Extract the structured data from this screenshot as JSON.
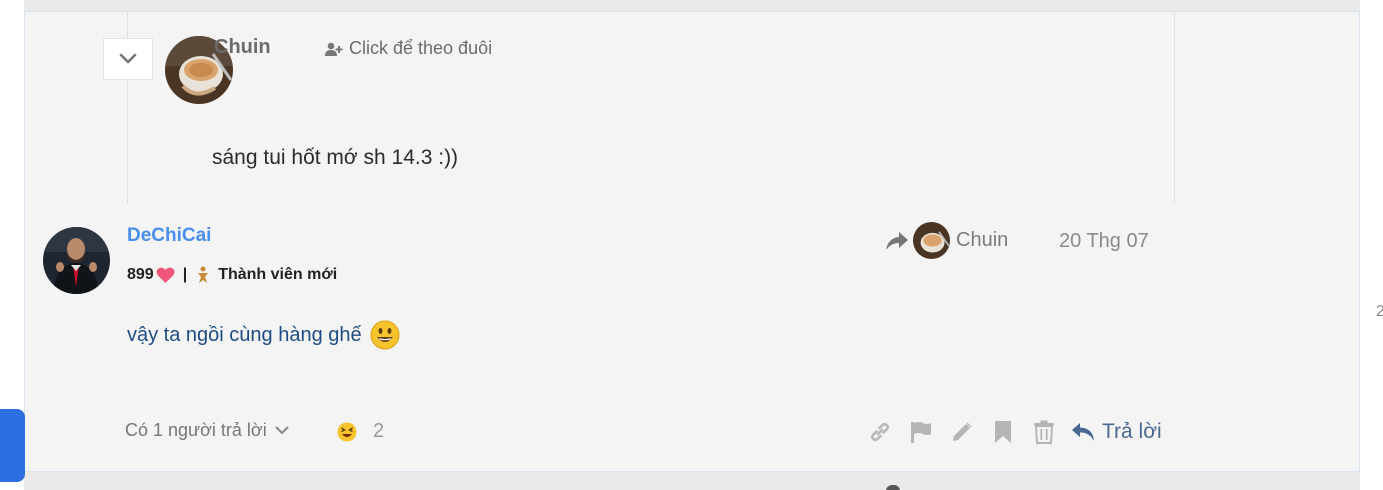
{
  "quote": {
    "author": "Chuin",
    "follow_label": "Click để theo đuôi",
    "text": "sáng tui hốt mớ sh 14.3 :))"
  },
  "post": {
    "author": "DeChiCai",
    "points": "899",
    "rank": "Thành viên mới",
    "reply_to": "Chuin",
    "date": "20 Thg 07",
    "body": "vậy ta ngồi cùng hàng ghế"
  },
  "footer": {
    "replies_label": "Có 1 người trả lời",
    "reaction_count": "2",
    "reply_button": "Trả lời"
  },
  "icons": {
    "collapse": "chevron-down-icon",
    "follow": "user-plus-icon",
    "heart": "heart-icon",
    "rank": "member-badge-icon",
    "reply_arrow": "share-arrow-icon",
    "link": "link-icon",
    "flag": "flag-icon",
    "edit": "pencil-icon",
    "bookmark": "bookmark-icon",
    "delete": "trash-icon",
    "reply": "reply-icon"
  },
  "colors": {
    "author_link": "#4a8ef0",
    "body_text": "#1f4c86",
    "heart": "#f0567a",
    "reply_button": "#4a6894",
    "side_tab": "#2d6fe0"
  }
}
